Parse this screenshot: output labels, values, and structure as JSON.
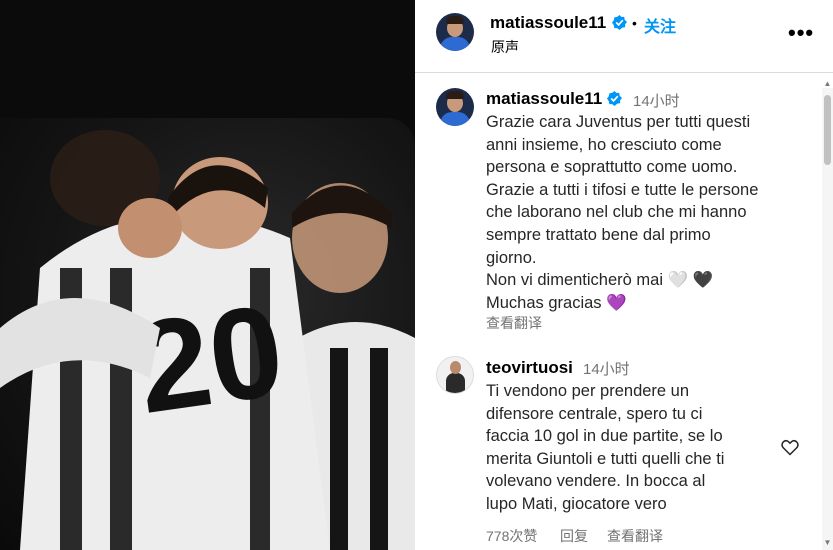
{
  "post": {
    "author": "matiassoule11",
    "follow_label": "关注",
    "audio_label": "原声",
    "more_label": "•••"
  },
  "caption": {
    "author": "matiassoule11",
    "time": "14小时",
    "text": "Grazie cara Juventus per tutti questi\nanni insieme, ho cresciuto come\npersona e soprattutto come uomo.\nGrazie a tutti i tifosi e tutte le persone\nche laborano nel club che mi hanno\nsempre trattato bene dal primo\ngiorno.\nNon vi dimenticherò mai 🤍 🖤\nMuchas gracias 💜",
    "translate_label": "查看翻译"
  },
  "comments": [
    {
      "author": "teovirtuosi",
      "time": "14小时",
      "text": "Ti vendono per prendere un\ndifensore centrale, spero tu ci\nfaccia 10 gol in due partite, se lo\nmerita Giuntoli e tutti quelli che ti\nvolevano vendere. In bocca al\nlupo Mati, giocatore vero",
      "likes": "778次赞",
      "reply_label": "回复",
      "translate_label": "查看翻译"
    }
  ],
  "icons": {
    "verified": "verified-badge-icon",
    "heart": "heart-outline-icon",
    "more": "more-options-icon"
  },
  "colors": {
    "link_blue": "#0095f6",
    "verified_blue": "#0095f6",
    "secondary_text": "#737373"
  }
}
